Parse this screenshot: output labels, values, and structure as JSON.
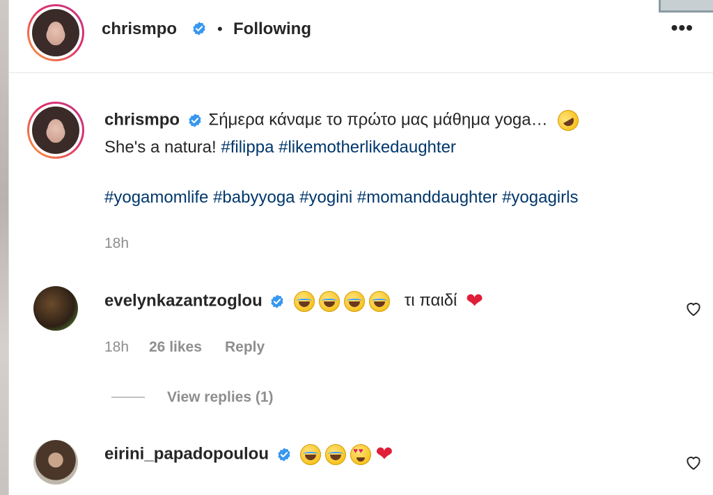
{
  "header": {
    "username": "chrismpo",
    "separator": "•",
    "follow_status": "Following",
    "more_label": "•••"
  },
  "caption": {
    "username": "chrismpo",
    "line1": "Σήμερα κάναμε το πρώτο μας μάθημα yoga…",
    "line2_text": "She's a natura! ",
    "line2_tags": [
      "#filippa",
      "#likemotherlikedaughter"
    ],
    "line3_tags": [
      "#yogamomlife",
      "#babyyoga",
      "#yogini",
      "#momanddaughter",
      "#yogagirls"
    ],
    "time": "18h"
  },
  "comments": [
    {
      "username": "evelynkazantzoglou",
      "emojis": [
        "face-with-tears-of-joy",
        "face-with-tears-of-joy",
        "face-with-tears-of-joy",
        "face-with-tears-of-joy"
      ],
      "text": "τι παιδί",
      "trailing_emoji": "red-heart",
      "time": "18h",
      "likes": "26 likes",
      "reply_label": "Reply",
      "view_replies": "View replies (1)"
    },
    {
      "username": "eirini_papadopoulou",
      "emojis": [
        "face-with-tears-of-joy",
        "face-with-tears-of-joy",
        "smiling-face-with-heart-eyes",
        "red-heart"
      ]
    }
  ],
  "colors": {
    "text": "#262626",
    "hashtag": "#00376b",
    "muted": "#8e8e8e",
    "verified": "#3897f0",
    "heart": "#e01e37"
  }
}
